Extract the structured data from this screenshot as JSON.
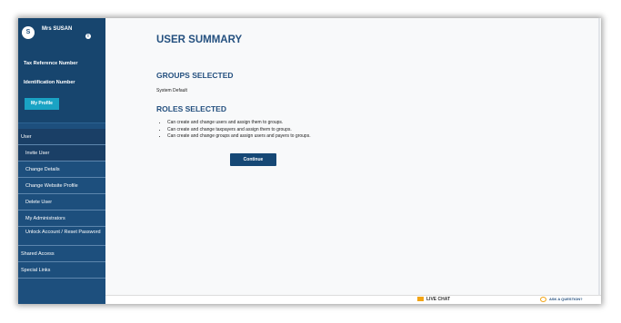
{
  "sidebar": {
    "avatar_initial": "S",
    "user_name": "Mrs SUSAN",
    "tax_ref_label": "Tax Reference Number",
    "id_label": "Identification Number",
    "my_profile": "My Profile",
    "items": [
      {
        "label": "User"
      },
      {
        "label": "Invite User"
      },
      {
        "label": "Change Details"
      },
      {
        "label": "Change Website Profile"
      },
      {
        "label": "Delete User"
      },
      {
        "label": "My Administrators"
      },
      {
        "label": "Unlock Account / Reset Password"
      },
      {
        "label": "Shared Access"
      },
      {
        "label": "Special Links"
      }
    ]
  },
  "main": {
    "title": "USER SUMMARY",
    "groups_title": "GROUPS SELECTED",
    "group_value": "System Default",
    "roles_title": "ROLES SELECTED",
    "roles": [
      "Can create and change users and assign them to groups.",
      "Can create and change taxpayers and assign them to groups.",
      "Can create and change groups and assign users and payers to groups."
    ],
    "continue": "Continue"
  },
  "footer": {
    "live_chat": "LIVE CHAT",
    "ask": "ASK A QUESTION?"
  }
}
